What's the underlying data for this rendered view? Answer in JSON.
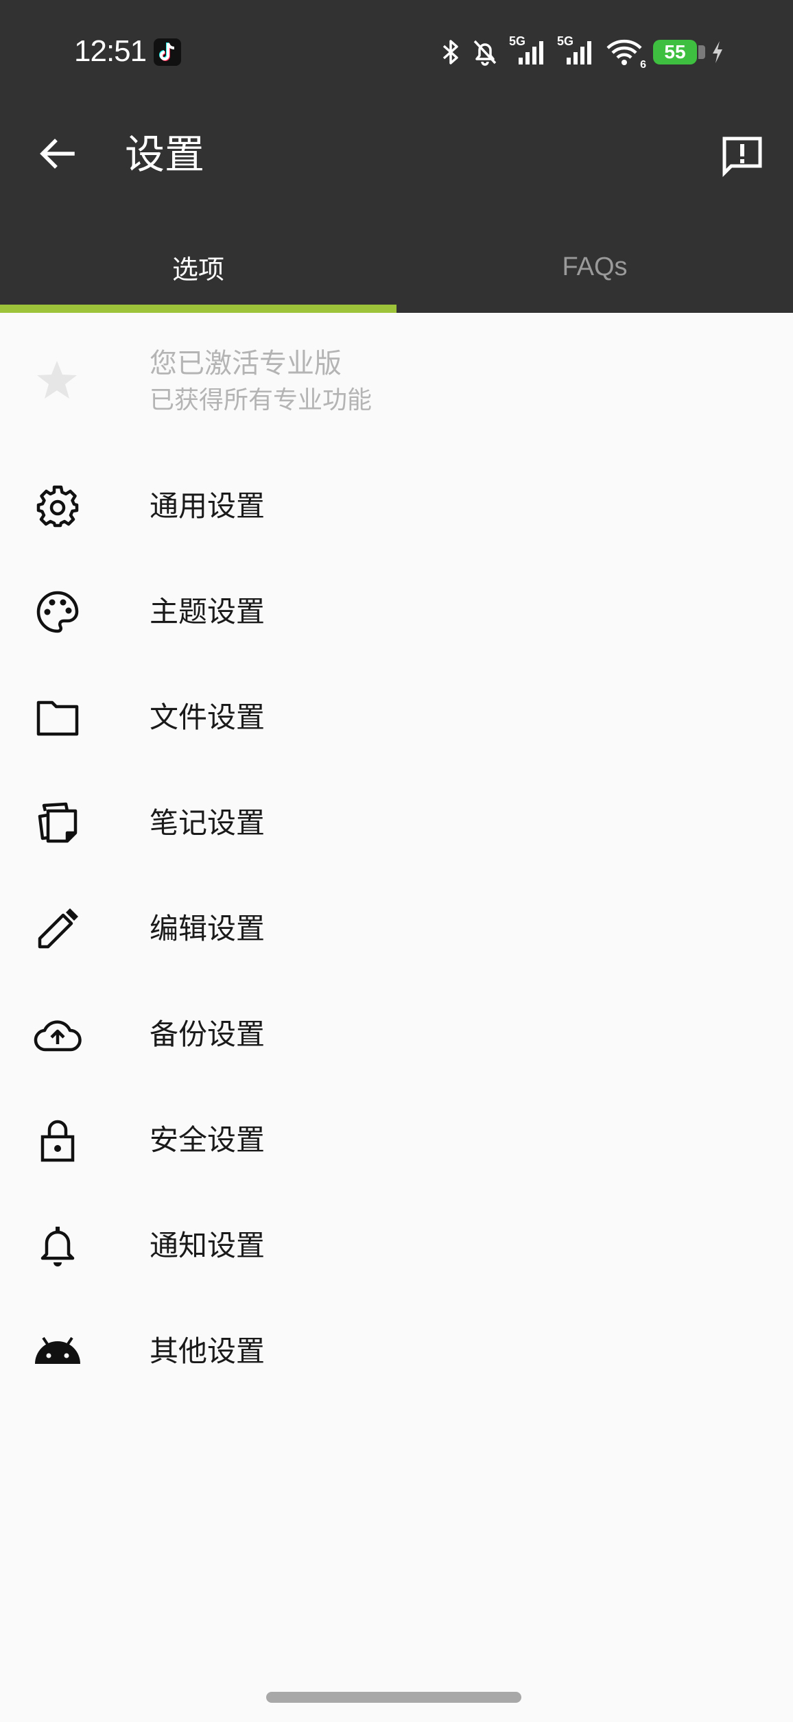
{
  "status_bar": {
    "time": "12:51",
    "network_label": "5G",
    "network_label_2": "5G",
    "wifi_badge": "6",
    "battery_level": "55"
  },
  "app_bar": {
    "title": "设置"
  },
  "tabs": [
    {
      "label": "选项",
      "active": true
    },
    {
      "label": "FAQs",
      "active": false
    }
  ],
  "pro_banner": {
    "title": "您已激活专业版",
    "subtitle": "已获得所有专业功能"
  },
  "settings_items": [
    {
      "label": "通用设置",
      "icon": "gear-icon"
    },
    {
      "label": "主题设置",
      "icon": "palette-icon"
    },
    {
      "label": "文件设置",
      "icon": "folder-icon"
    },
    {
      "label": "笔记设置",
      "icon": "notes-icon"
    },
    {
      "label": "编辑设置",
      "icon": "pencil-icon"
    },
    {
      "label": "备份设置",
      "icon": "cloud-upload-icon"
    },
    {
      "label": "安全设置",
      "icon": "lock-icon"
    },
    {
      "label": "通知设置",
      "icon": "bell-icon"
    },
    {
      "label": "其他设置",
      "icon": "android-icon"
    }
  ],
  "colors": {
    "app_bar": "#323232",
    "tab_indicator": "#9dc33b",
    "background": "#fafafa",
    "battery": "#3fbf3f"
  }
}
